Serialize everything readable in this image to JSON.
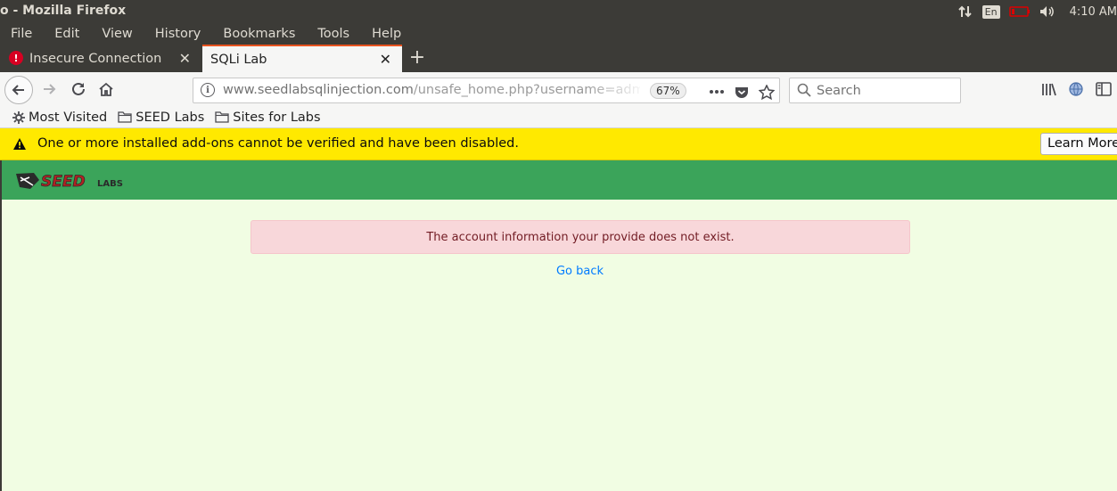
{
  "window": {
    "title": "o - Mozilla Firefox"
  },
  "tray": {
    "keyboard": "En",
    "time": "4:10 AM"
  },
  "menu": [
    "File",
    "Edit",
    "View",
    "History",
    "Bookmarks",
    "Tools",
    "Help"
  ],
  "tabs": [
    {
      "label": "Insecure Connection",
      "active": false
    },
    {
      "label": "SQLi Lab",
      "active": true
    }
  ],
  "urlbar": {
    "host": "www.seedlabsqlinjection.com",
    "path": "/unsafe_home.php?username=adm",
    "zoom": "67%"
  },
  "search": {
    "placeholder": "Search"
  },
  "bookmarks": [
    "Most Visited",
    "SEED Labs",
    "Sites for Labs"
  ],
  "notification": {
    "message": "One or more installed add-ons cannot be verified and have been disabled.",
    "button": "Learn More"
  },
  "site": {
    "logo": {
      "seed": "SEED",
      "labs": "LABS"
    },
    "alert": "The account information your provide does not exist.",
    "back_link": "Go back"
  },
  "colors": {
    "chrome_dark": "#3c3b37",
    "tab_accent": "#e95420",
    "notification": "#ffe900",
    "site_header": "#3ba45a",
    "page_bg": "#f1fde3",
    "alert_bg": "#f8d7da",
    "alert_text": "#721c24",
    "link": "#007bff"
  }
}
